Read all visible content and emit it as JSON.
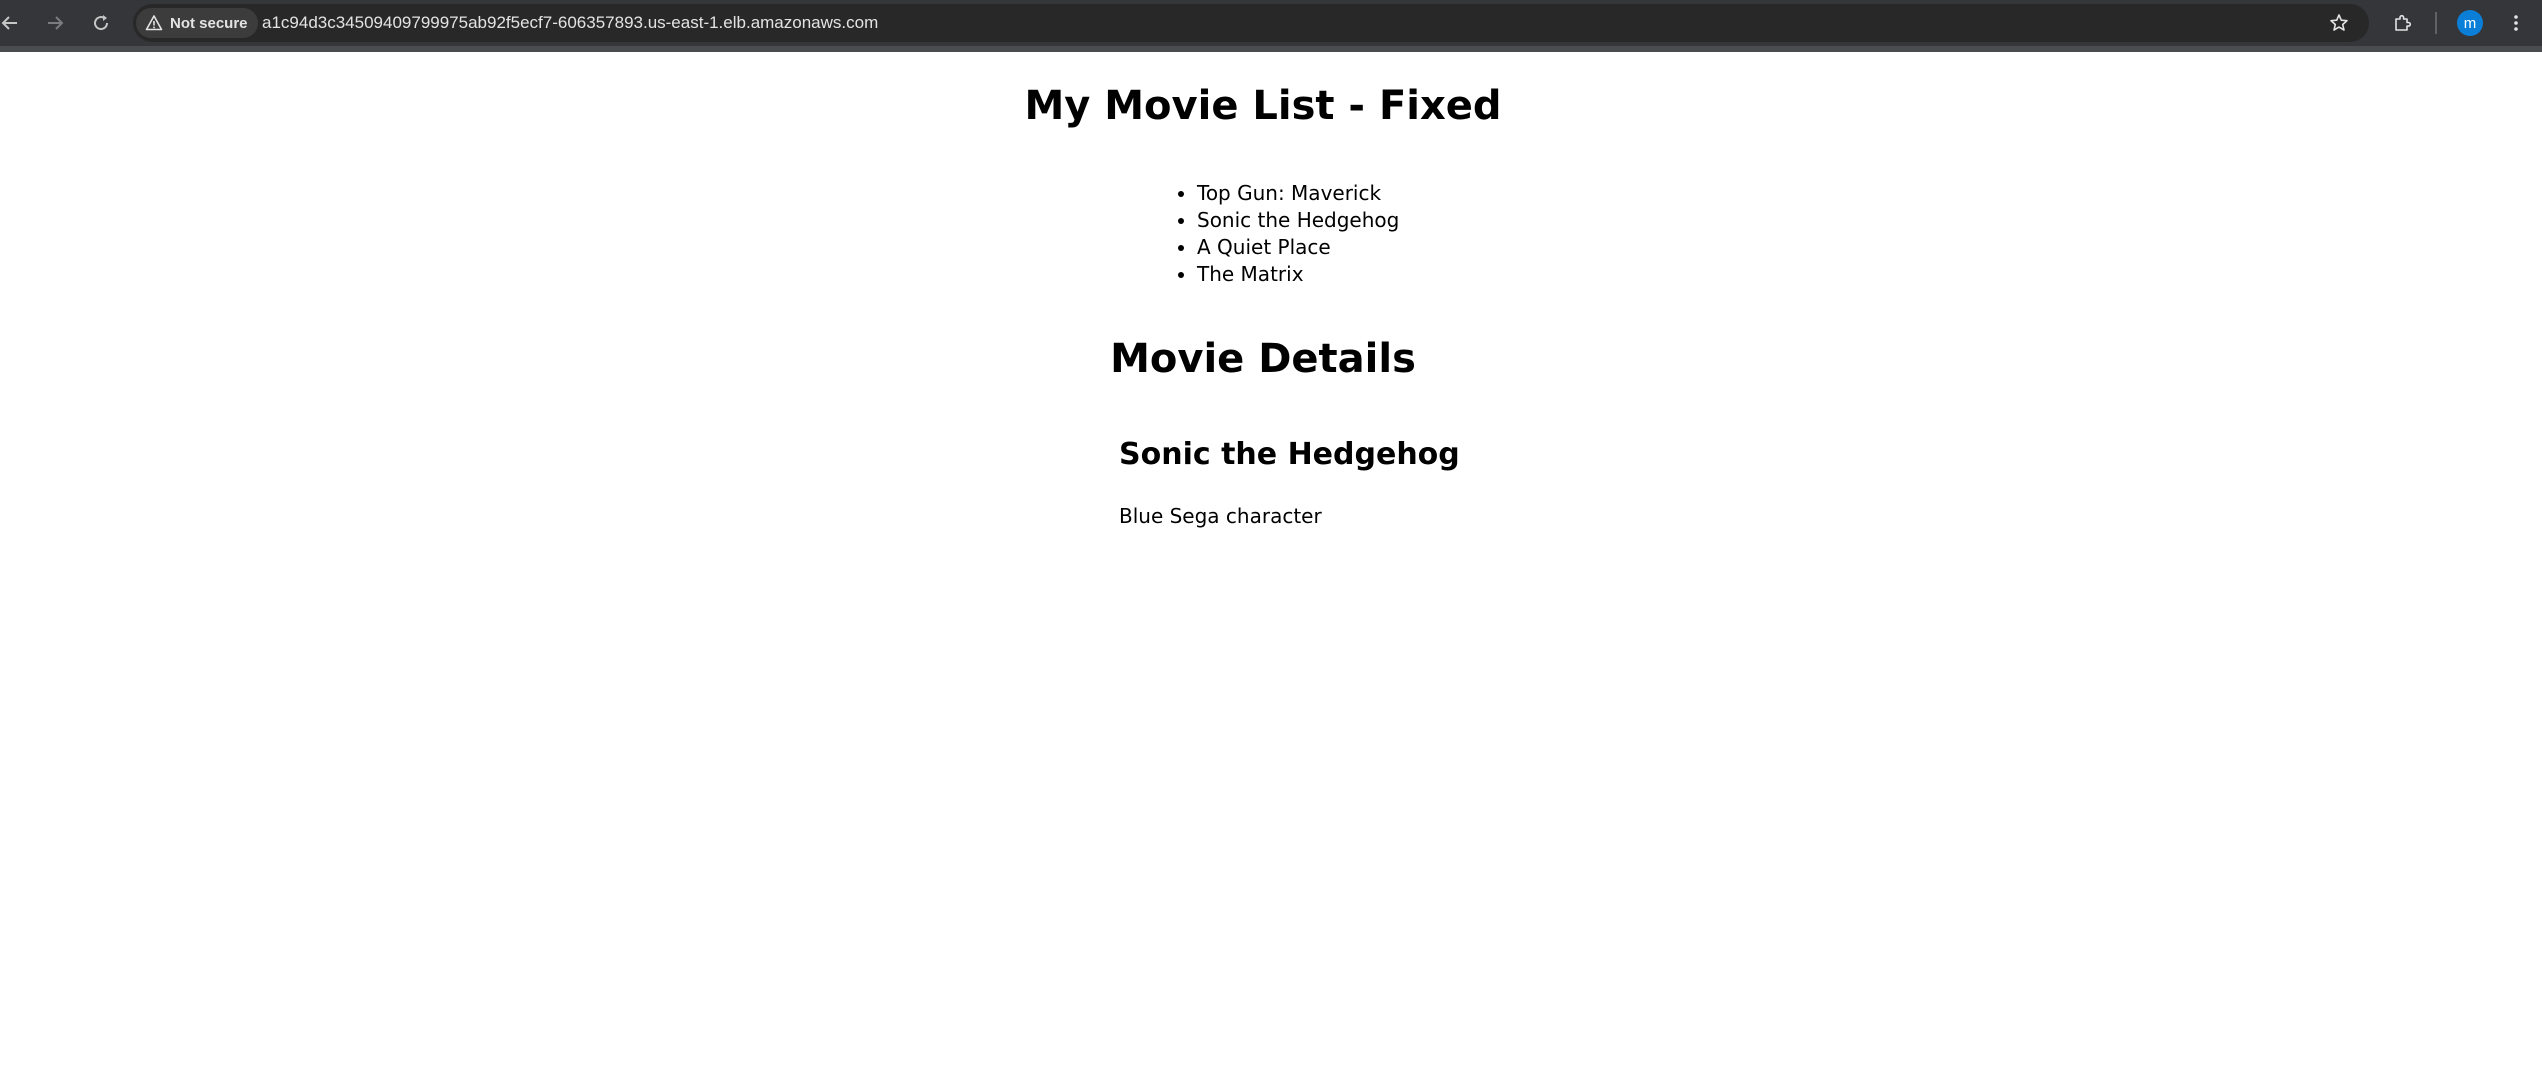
{
  "browser": {
    "security_label": "Not secure",
    "url": "a1c94d3c34509409799975ab92f5ecf7-606357893.us-east-1.elb.amazonaws.com",
    "profile_initial": "m",
    "icons": {
      "back": "back-arrow-icon",
      "forward": "forward-arrow-icon",
      "reload": "reload-icon",
      "warning": "warning-icon",
      "star": "star-icon",
      "extensions": "puzzle-icon",
      "menu": "kebab-menu-icon"
    },
    "colors": {
      "toolbar": "#35363a",
      "omnibox": "#282828",
      "avatar": "#0b7fd8"
    }
  },
  "page": {
    "title": "My Movie List - Fixed",
    "movies": [
      "Top Gun: Maverick",
      "Sonic the Hedgehog",
      "A Quiet Place",
      "The Matrix"
    ],
    "details_title": "Movie Details",
    "selected_movie": {
      "name": "Sonic the Hedgehog",
      "description": "Blue Sega character"
    }
  }
}
